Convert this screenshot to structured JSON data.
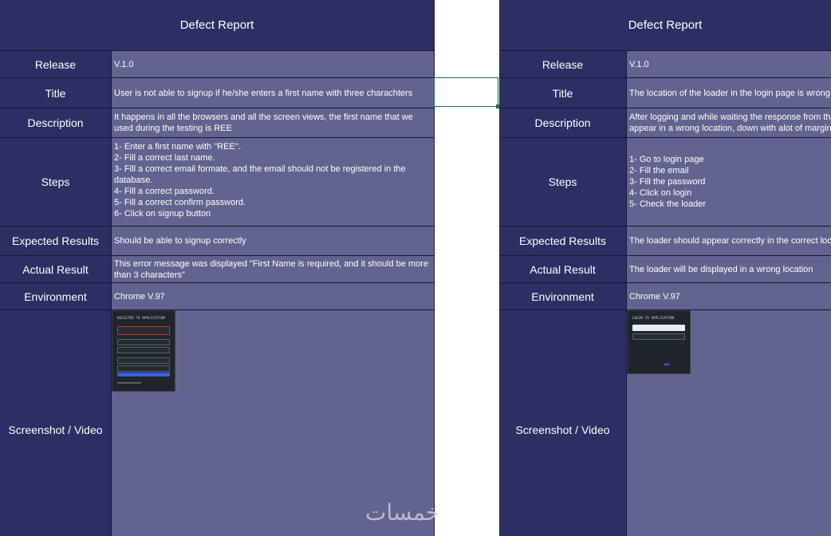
{
  "left": {
    "header": "Defect Report",
    "labels": {
      "release": "Release",
      "title": "Title",
      "description": "Description",
      "steps": "Steps",
      "expected": "Expected Results",
      "actual": "Actual Result",
      "environment": "Environment",
      "screenshot": "Screenshot / Video"
    },
    "values": {
      "release": "V.1.0",
      "title": "User is not able to signup if he/she enters a first name with three charachters",
      "description": "It happens in all the browsers and all the screen views, the first name that we\nused during the testing is REE",
      "steps": "1- Enter a first name with \"REE\".\n2- Fill a correct last name.\n3- Fill a correct email formate, and the email should not be registered in the\ndatabase.\n4- Fill a correct password.\n5- Fill a correct confirm password.\n6- Click on signup button",
      "expected": "Should be able to signup correctly",
      "actual": "This error message was displayed \"First Name is required, and it should be more\nthan 3 characters\"",
      "environment": "Chrome V.97"
    },
    "thumbnail": {
      "title": "REGISTER TO APPLICATION"
    }
  },
  "right": {
    "header": "Defect Report",
    "labels": {
      "release": "Release",
      "title": "Title",
      "description": "Description",
      "steps": "Steps",
      "expected": "Expected Results",
      "actual": "Actual Result",
      "environment": "Environment",
      "screenshot": "Screenshot / Video"
    },
    "values": {
      "release": "V.1.0",
      "title": "The location of the loader in the login page is wrong",
      "description": "After logging and while waiting the response from th\nappear in a wrong location, down with alot of margin",
      "steps": "1- Go to login page\n2- Fill the email\n3- Fill the password\n4- Click on login\n5- Check the loader",
      "expected": "The loader should appear correctly in the correct loc",
      "actual": "The loader will be displayed in a wrong location",
      "environment": "Chrome V.97"
    },
    "thumbnail": {
      "title": "LOGIN TO APPLICATION"
    }
  },
  "watermark": "خمسات",
  "colors": {
    "header_bg": "#2b2f63",
    "value_bg": "#63638f",
    "selection": "#1e7145"
  }
}
